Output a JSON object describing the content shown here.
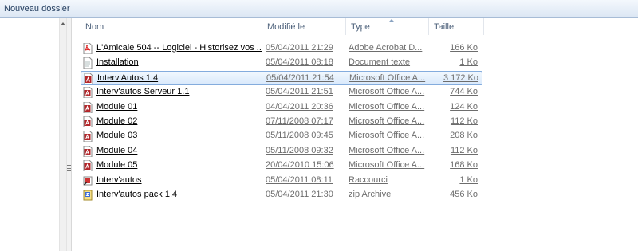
{
  "toolbar": {
    "new_folder": "Nouveau dossier"
  },
  "columns": {
    "name": "Nom",
    "modified": "Modifié le",
    "type": "Type",
    "size": "Taille"
  },
  "files": [
    {
      "name": "L'Amicale 504 -- Logiciel - Historisez vos ...",
      "modified": "05/04/2011 21:29",
      "type": "Adobe Acrobat D...",
      "size": "166 Ko",
      "icon": "pdf-icon"
    },
    {
      "name": "Installation",
      "modified": "05/04/2011 08:18",
      "type": "Document texte",
      "size": "1 Ko",
      "icon": "text-file-icon"
    },
    {
      "name": "Interv'Autos 1.4",
      "modified": "05/04/2011 21:54",
      "type": "Microsoft Office A...",
      "size": "3 172 Ko",
      "icon": "access-file-icon",
      "selected": true
    },
    {
      "name": "Interv'autos Serveur 1.1",
      "modified": "05/04/2011 21:51",
      "type": "Microsoft Office A...",
      "size": "744 Ko",
      "icon": "access-file-icon"
    },
    {
      "name": "Module 01",
      "modified": "04/04/2011 20:36",
      "type": "Microsoft Office A...",
      "size": "124 Ko",
      "icon": "access-file-icon"
    },
    {
      "name": "Module 02",
      "modified": "07/11/2008 07:17",
      "type": "Microsoft Office A...",
      "size": "112 Ko",
      "icon": "access-file-icon"
    },
    {
      "name": "Module 03",
      "modified": "05/11/2008 09:45",
      "type": "Microsoft Office A...",
      "size": "208 Ko",
      "icon": "access-file-icon"
    },
    {
      "name": "Module 04",
      "modified": "05/11/2008 09:32",
      "type": "Microsoft Office A...",
      "size": "112 Ko",
      "icon": "access-file-icon"
    },
    {
      "name": "Module 05",
      "modified": "20/04/2010 15:06",
      "type": "Microsoft Office A...",
      "size": "168 Ko",
      "icon": "access-file-icon"
    },
    {
      "name": "Interv'autos",
      "modified": "05/04/2011 08:11",
      "type": "Raccourci",
      "size": "1 Ko",
      "icon": "shortcut-icon"
    },
    {
      "name": "Interv'autos pack 1.4",
      "modified": "05/04/2011 21:30",
      "type": "zip Archive",
      "size": "456 Ko",
      "icon": "zip-archive-icon"
    }
  ],
  "colors": {
    "selection_border": "#84acdd",
    "header_text": "#4c607a",
    "toolbar_text": "#1e395b"
  }
}
